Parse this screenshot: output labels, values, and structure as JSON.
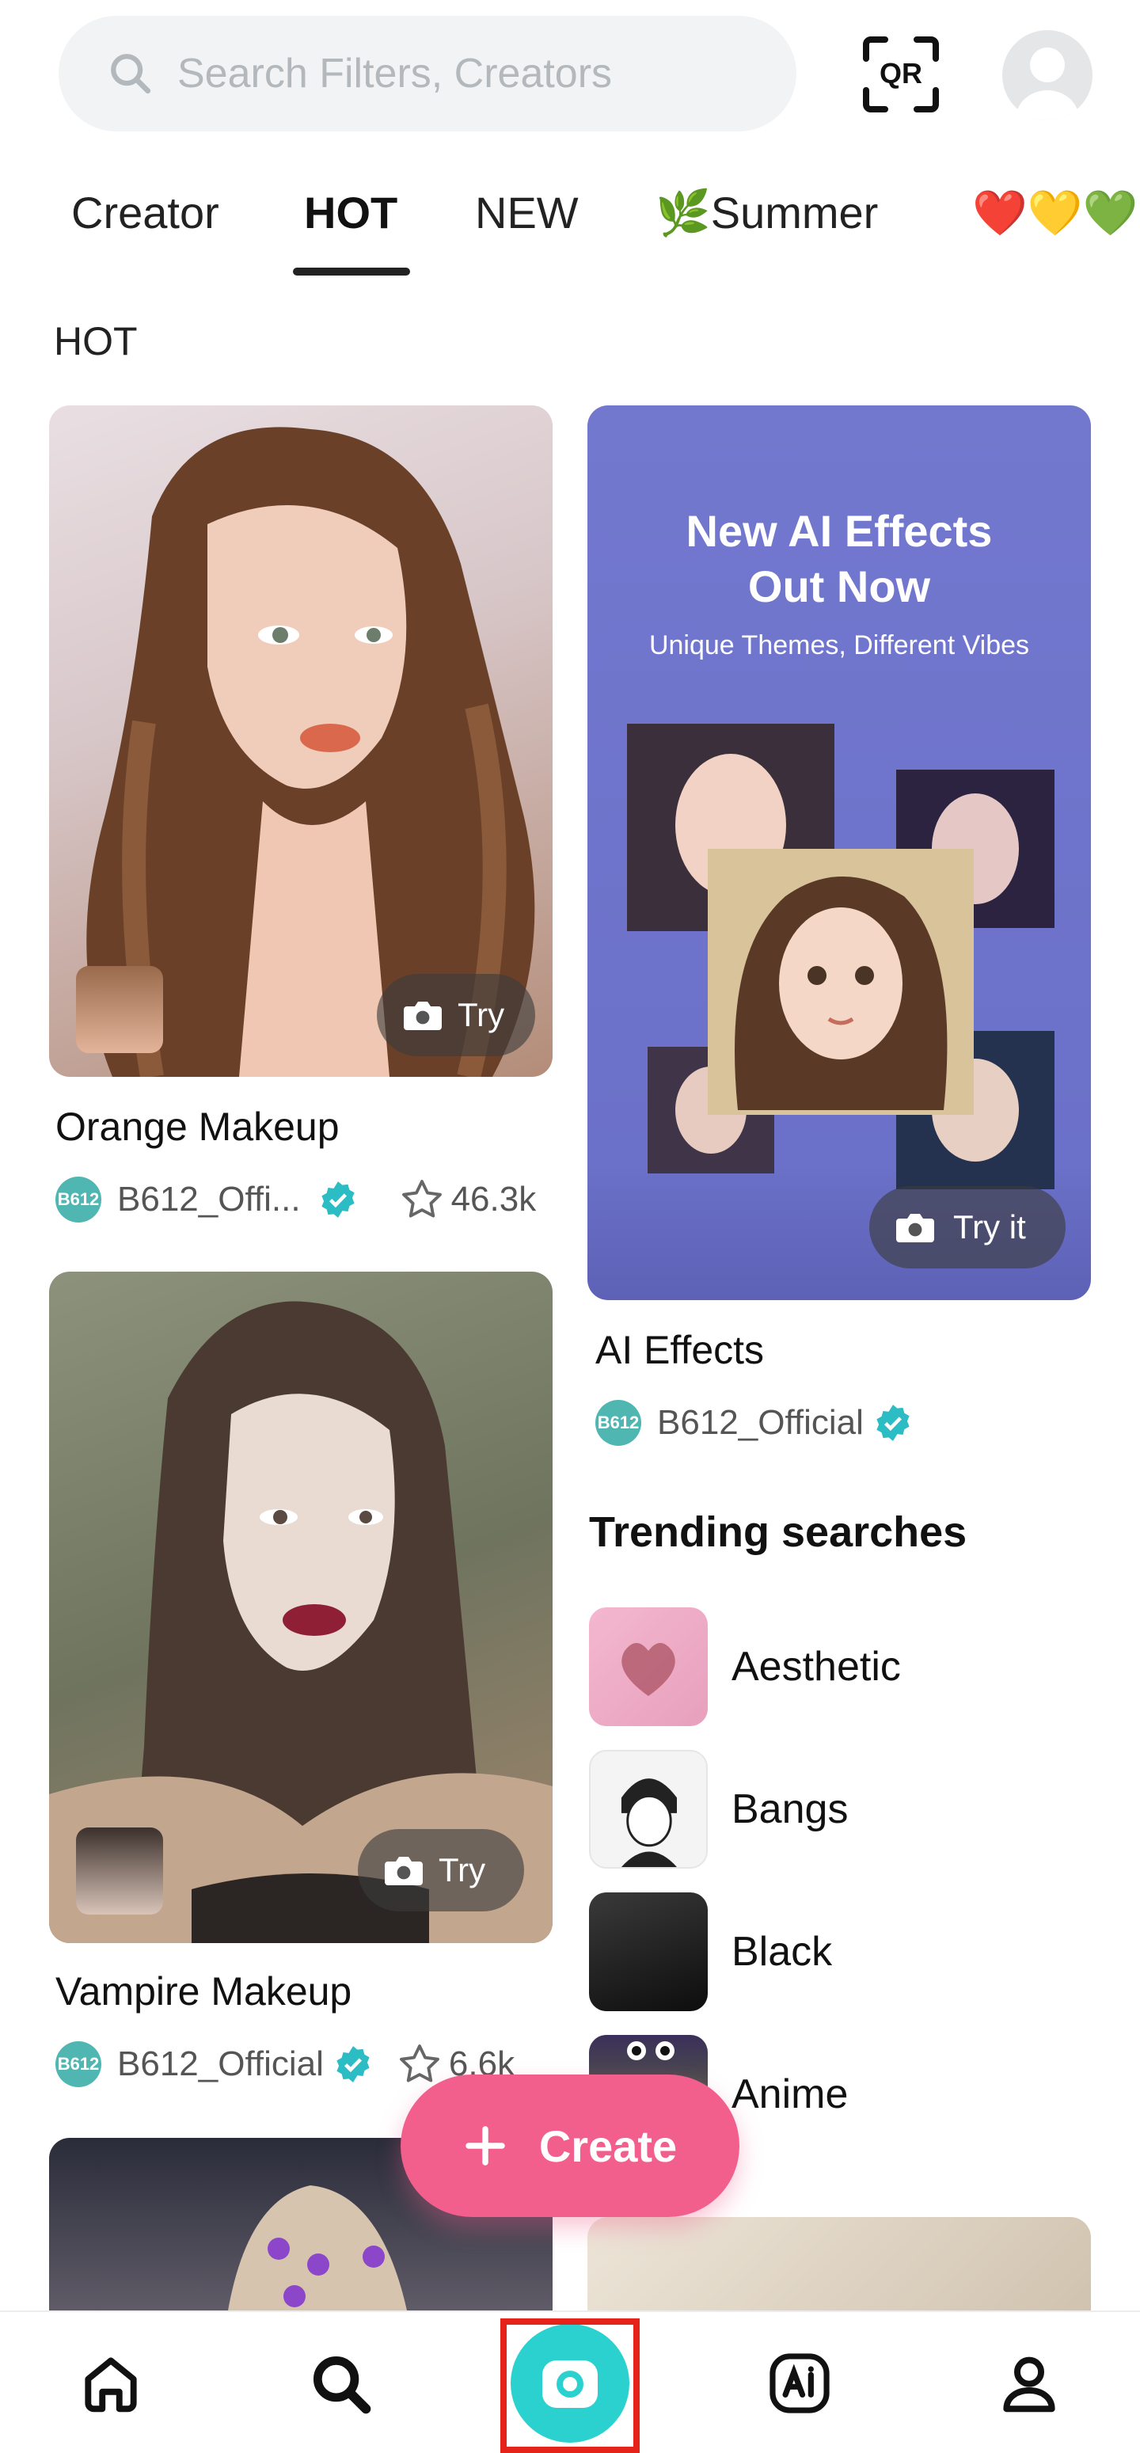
{
  "search": {
    "placeholder": "Search Filters, Creators",
    "icon": "search-icon"
  },
  "header": {
    "qr_label": "QR"
  },
  "tabs": [
    {
      "label": "Creator",
      "active": false
    },
    {
      "label": "HOT",
      "active": true
    },
    {
      "label": "NEW",
      "active": false
    },
    {
      "label": "🌿Summer",
      "active": false
    },
    {
      "label": "❤️💛💚",
      "active": false
    }
  ],
  "section": {
    "title": "HOT"
  },
  "cards": [
    {
      "title": "Orange Makeup",
      "creator": "B612_Offi...",
      "likes": "46.3k",
      "try_label": "Try"
    },
    {
      "title": "Vampire Makeup",
      "creator": "B612_Official",
      "likes": "6.6k",
      "try_label": "Try"
    }
  ],
  "promo": {
    "headline1": "New AI Effects",
    "headline2": "Out Now",
    "subline": "Unique Themes, Different Vibes",
    "try_label": "Try it",
    "title": "AI Effects",
    "creator": "B612_Official"
  },
  "logo_text": "B612",
  "trending": {
    "title": "Trending searches",
    "items": [
      {
        "label": "Aesthetic"
      },
      {
        "label": "Bangs"
      },
      {
        "label": "Black"
      },
      {
        "label": "Anime"
      }
    ]
  },
  "fab": {
    "label": "Create"
  },
  "bottom_nav": [
    "home-icon",
    "search-icon",
    "camera-icon",
    "ai-icon",
    "profile-icon"
  ],
  "colors": {
    "accent_pink": "#f25f8d",
    "camera_teal": "#2ad1cf",
    "verified_teal": "#2bbcc4",
    "promo_purple": "#7378cf",
    "highlight_red": "#e6231b"
  }
}
